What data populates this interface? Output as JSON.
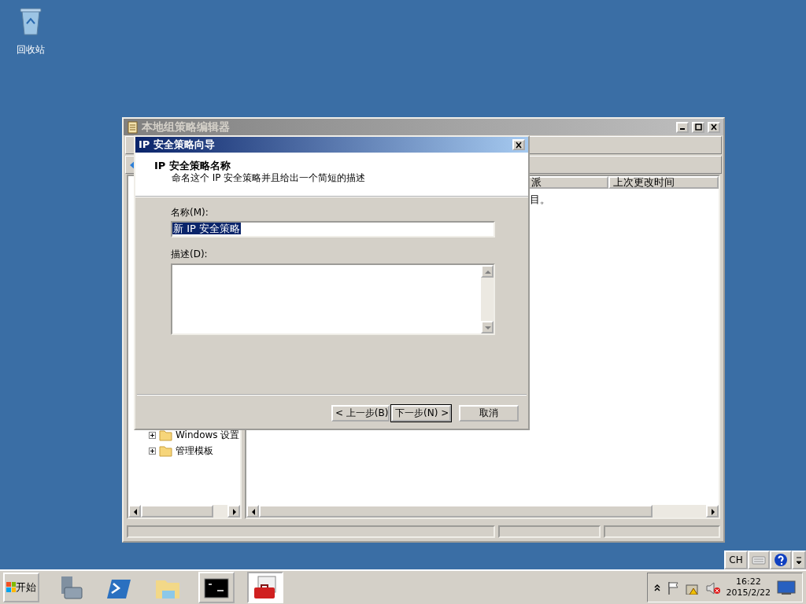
{
  "desktop_icons": [
    {
      "label": "回收站"
    }
  ],
  "background_window": {
    "title": "本地组策略编辑器",
    "tree": [
      {
        "label": "Windows 设置",
        "expanded": false
      },
      {
        "label": "管理模板",
        "expanded": false
      }
    ],
    "columns": [
      "派",
      "上次更改时间"
    ],
    "content_text": "目。"
  },
  "dialog": {
    "title": "IP 安全策略向导",
    "heading": "IP 安全策略名称",
    "subtitle": "命名这个 IP 安全策略并且给出一个简短的描述",
    "name_label": "名称(M):",
    "name_value": "新 IP 安全策略",
    "name_value_selected": true,
    "description_label": "描述(D):",
    "buttons": [
      {
        "label": "< 上一步(B)",
        "default": false
      },
      {
        "label": "下一步(N) >",
        "default": true
      },
      {
        "label": "取消",
        "default": false
      }
    ]
  },
  "language_bar": {
    "language": "CH"
  },
  "taskbar": {
    "start_label": "开始",
    "apps": [
      {
        "kind": "server-manager",
        "active": false
      },
      {
        "kind": "powershell",
        "active": false
      },
      {
        "kind": "explorer",
        "active": false
      },
      {
        "kind": "cmd",
        "active": false
      },
      {
        "kind": "toolbox",
        "active": true
      }
    ],
    "time": "16:22",
    "date": "2015/2/22"
  }
}
